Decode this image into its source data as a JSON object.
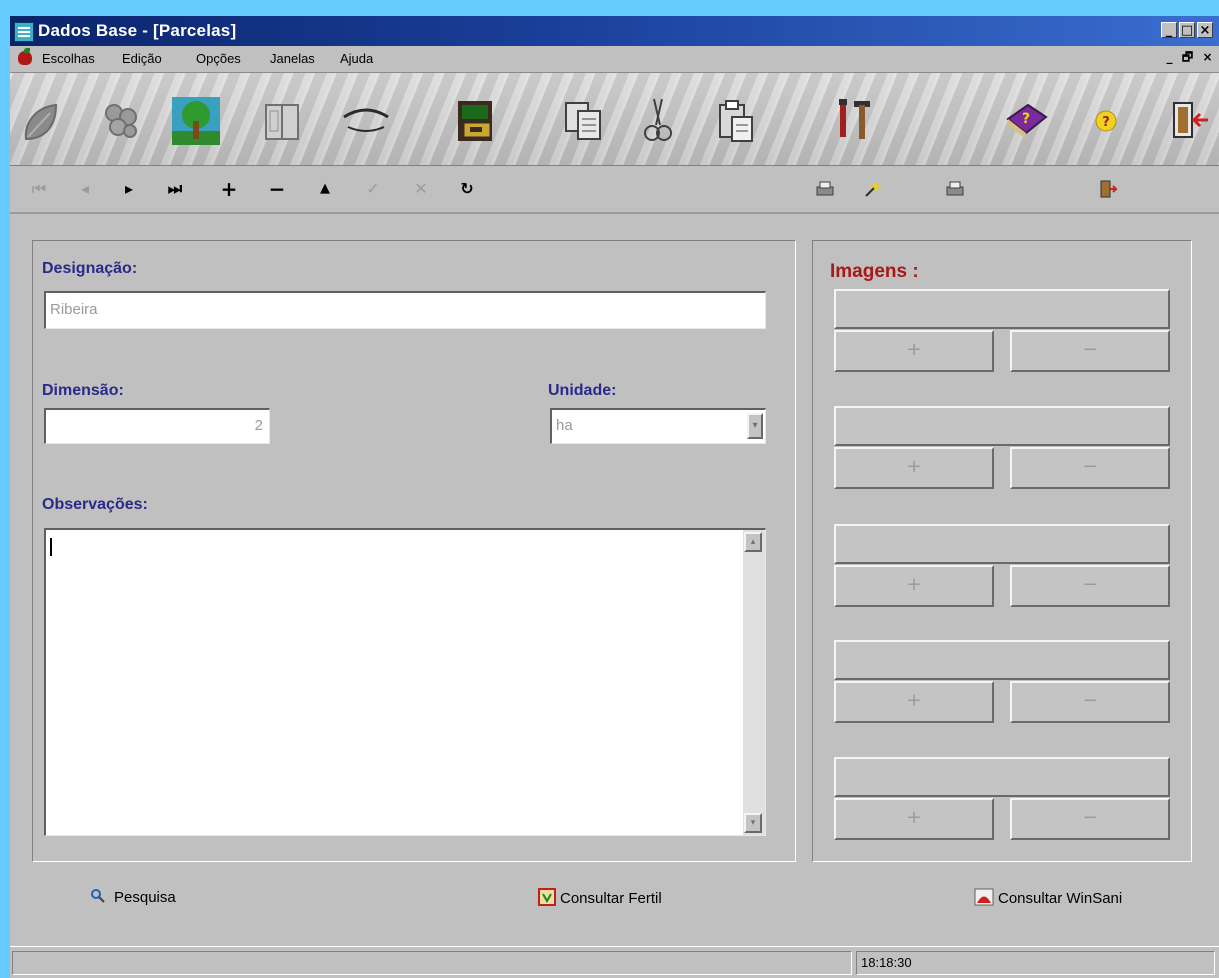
{
  "window": {
    "title": "Dados Base - [Parcelas]",
    "caption_buttons": [
      "_",
      "□",
      "×"
    ],
    "mdi_buttons": [
      "_",
      "🗗",
      "×"
    ]
  },
  "menu": {
    "items": [
      "Escolhas",
      "Edição",
      "Opções",
      "Janelas",
      "Ajuda"
    ]
  },
  "big_toolbar": {
    "icons": [
      "leaf-icon",
      "grapes-icon",
      "tree-icon",
      "book-icon",
      "eye-icon",
      "file-cabinet-icon",
      "copy-icon",
      "scissors-icon",
      "paste-icon",
      "tools-icon",
      "help-book-icon",
      "question-icon",
      "exit-door-icon"
    ]
  },
  "nav_toolbar": {
    "first": "⏮",
    "prev": "◂",
    "next": "▸",
    "last": "⏭",
    "add": "+",
    "remove": "−",
    "up": "▲",
    "confirm": "✓",
    "cancel": "✕",
    "refresh": "↻"
  },
  "form": {
    "designacao_label": "Designação:",
    "designacao_value": "Ribeira",
    "dimensao_label": "Dimensão:",
    "dimensao_value": "2",
    "unidade_label": "Unidade:",
    "unidade_value": "ha",
    "observacoes_label": "Observações:",
    "observacoes_value": ""
  },
  "images": {
    "label": "Imagens :",
    "slots": [
      {
        "add": "+",
        "remove": "−"
      },
      {
        "add": "+",
        "remove": "−"
      },
      {
        "add": "+",
        "remove": "−"
      },
      {
        "add": "+",
        "remove": "−"
      },
      {
        "add": "+",
        "remove": "−"
      }
    ]
  },
  "footer": {
    "pesquisa": "Pesquisa",
    "consultar_fertil": "Consultar Fertil",
    "consultar_winsani": "Consultar WinSani"
  },
  "status": {
    "time": "18:18:30"
  }
}
